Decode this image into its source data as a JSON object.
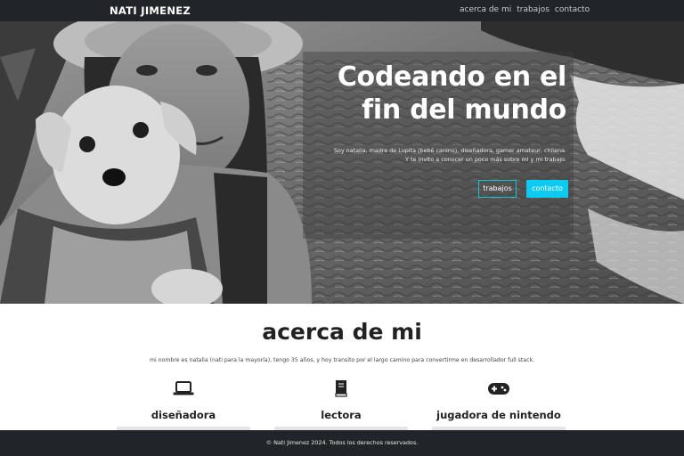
{
  "nav": {
    "brand": "NATI JIMENEZ",
    "links": [
      "acerca de mi",
      "trabajos",
      "contacto"
    ]
  },
  "hero": {
    "title": "Codeando en el fin del mundo",
    "lead_line1": "Soy natalia, madre de Lupita (bebé canino), diseñadora, gamer amateur, chilena.",
    "lead_line2": "Y te invito a conocer un poco más sobre mi y mi trabajo.",
    "btn_works": "trabajos",
    "btn_contact": "contacto"
  },
  "about": {
    "title": "acerca de mi",
    "text": "mi nombre es natalia (nati para la mayoría), tengo 35 años, y hoy transito por el largo camino para convertirme en desarrollador full stack.",
    "features": [
      {
        "icon": "laptop-icon",
        "title": "diseñadora"
      },
      {
        "icon": "book-icon",
        "title": "lectora"
      },
      {
        "icon": "gamepad-icon",
        "title": "jugadora de nintendo"
      }
    ]
  },
  "footer": {
    "text": "© Nati Jimenez 2024. Todos los derechos reservados."
  },
  "colors": {
    "dark": "#212529",
    "accent": "#0dcaf0"
  }
}
